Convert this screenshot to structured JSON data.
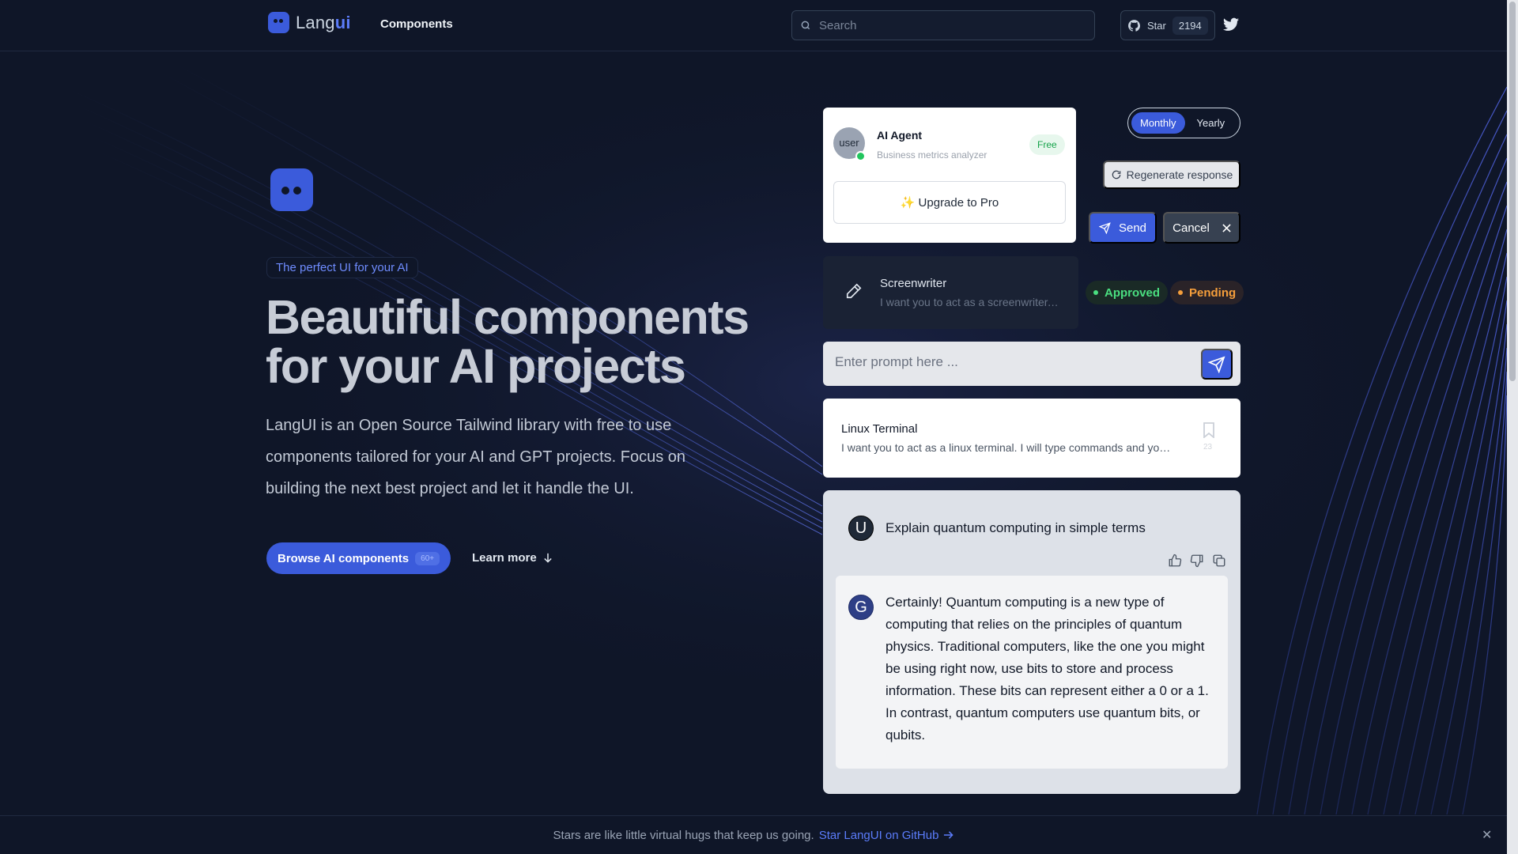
{
  "header": {
    "logo_text": "Lang",
    "logo_accent": "ui",
    "nav": [
      "Components"
    ],
    "search_placeholder": "Search",
    "github_star_label": "Star",
    "github_star_count": "2194"
  },
  "hero": {
    "tagline": "The perfect UI for your AI",
    "headline_line1": "Beautiful components",
    "headline_line2": "for your AI projects",
    "description": "LangUI is an Open Source Tailwind library with free to use components tailored for your AI and GPT projects. Focus on building the next best project and let it handle the UI.",
    "browse_button": "Browse AI components",
    "browse_badge": "60+",
    "learn_more": "Learn more"
  },
  "agent_card": {
    "avatar_alt": "user",
    "name": "AI Agent",
    "subtitle": "Business metrics analyzer",
    "badge": "Free",
    "upgrade_button": "✨ Upgrade to Pro"
  },
  "billing_toggle": {
    "options": [
      "Monthly",
      "Yearly"
    ],
    "selected": "Monthly"
  },
  "actions": {
    "regenerate": "Regenerate response",
    "send": "Send",
    "cancel": "Cancel"
  },
  "screenwriter_card": {
    "title": "Screenwriter",
    "description": "I want you to act as a screenwriter. You will develop an engaging and creative script"
  },
  "statuses": {
    "approved": "Approved",
    "pending": "Pending"
  },
  "prompt_input": {
    "placeholder": "Enter prompt here ..."
  },
  "linux_card": {
    "title": "Linux Terminal",
    "description": "I want you to act as a linux terminal. I will type commands and you will reply with what the terminal should show.",
    "count": "23"
  },
  "chat": {
    "user_initial": "U",
    "user_message": "Explain quantum computing in simple terms",
    "assistant_initial": "G",
    "assistant_message": "Certainly! Quantum computing is a new type of computing that relies on the principles of quantum physics. Traditional computers, like the one you might be using right now, use bits to store and process information. These bits can represent either a 0 or a 1. In contrast, quantum computers use quantum bits, or qubits."
  },
  "banner": {
    "text": "Stars are like little virtual hugs that keep us going.",
    "link": "Star LangUI on GitHub"
  },
  "colors": {
    "accent": "#3b5bdb",
    "background": "#0f1628",
    "approved": "#4ade80",
    "pending": "#f59e3b"
  }
}
